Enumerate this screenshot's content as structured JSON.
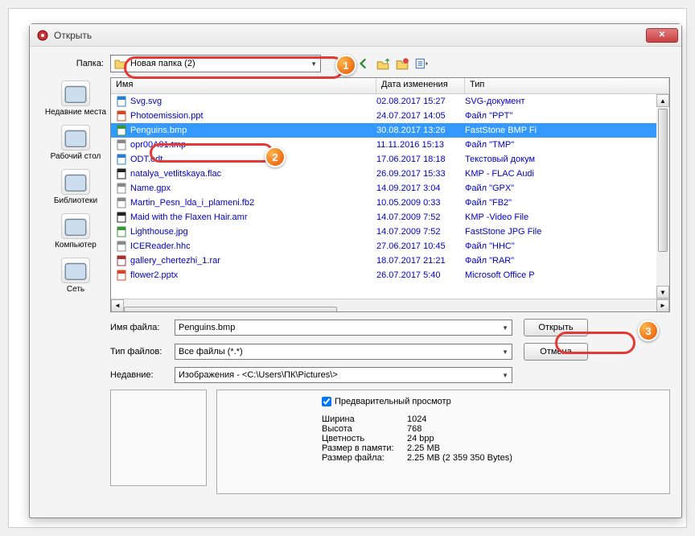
{
  "window": {
    "title": "Открыть"
  },
  "folderRow": {
    "label": "Папка:",
    "value": "Новая папка (2)"
  },
  "toolbar": {
    "back": "back-icon",
    "up": "up-icon",
    "newfolder": "newfolder-icon",
    "viewmenu": "viewmenu-icon"
  },
  "places": [
    {
      "label": "Недавние места"
    },
    {
      "label": "Рабочий стол"
    },
    {
      "label": "Библиотеки"
    },
    {
      "label": "Компьютер"
    },
    {
      "label": "Сеть"
    }
  ],
  "columns": {
    "name": "Имя",
    "date": "Дата изменения",
    "type": "Тип"
  },
  "files": [
    {
      "name": "Svg.svg",
      "date": "02.08.2017 15:27",
      "type": "SVG-документ",
      "sel": false,
      "iconColor": "#2b7cd3"
    },
    {
      "name": "Photoemission.ppt",
      "date": "24.07.2017 14:05",
      "type": "Файл \"PPT\"",
      "sel": false,
      "iconColor": "#d04828"
    },
    {
      "name": "Penguins.bmp",
      "date": "30.08.2017 13:26",
      "type": "FastStone BMP Fi",
      "sel": true,
      "iconColor": "#3a943a"
    },
    {
      "name": "opr00A91.tmp",
      "date": "11.11.2016 15:13",
      "type": "Файл \"TMP\"",
      "sel": false,
      "iconColor": "#888888"
    },
    {
      "name": "ODT.odt",
      "date": "17.06.2017 18:18",
      "type": "Текстовый докум",
      "sel": false,
      "iconColor": "#2b7cd3"
    },
    {
      "name": "natalya_vetlitskaya.flac",
      "date": "26.09.2017 15:33",
      "type": "KMP - FLAC Audi",
      "sel": false,
      "iconColor": "#222222"
    },
    {
      "name": "Name.gpx",
      "date": "14.09.2017 3:04",
      "type": "Файл \"GPX\"",
      "sel": false,
      "iconColor": "#888888"
    },
    {
      "name": "Martin_Pesn_lda_i_plameni.fb2",
      "date": "10.05.2009 0:33",
      "type": "Файл \"FB2\"",
      "sel": false,
      "iconColor": "#888888"
    },
    {
      "name": "Maid with the Flaxen Hair.amr",
      "date": "14.07.2009 7:52",
      "type": "KMP -Video File",
      "sel": false,
      "iconColor": "#222222"
    },
    {
      "name": "Lighthouse.jpg",
      "date": "14.07.2009 7:52",
      "type": "FastStone JPG File",
      "sel": false,
      "iconColor": "#3a943a"
    },
    {
      "name": "ICEReader.hhc",
      "date": "27.06.2017 10:45",
      "type": "Файл \"HHC\"",
      "sel": false,
      "iconColor": "#888888"
    },
    {
      "name": "gallery_chertezhi_1.rar",
      "date": "18.07.2017 21:21",
      "type": "Файл \"RAR\"",
      "sel": false,
      "iconColor": "#a33232"
    },
    {
      "name": "flower2.pptx",
      "date": "26.07.2017 5:40",
      "type": "Microsoft Office P",
      "sel": false,
      "iconColor": "#d04828"
    }
  ],
  "filenameRow": {
    "label": "Имя файла:",
    "value": "Penguins.bmp"
  },
  "filetypeRow": {
    "label": "Тип файлов:",
    "value": "Все файлы (*.*)"
  },
  "recentRow": {
    "label": "Недавние:",
    "value": "Изображения  -  <C:\\Users\\ПК\\Pictures\\>"
  },
  "buttons": {
    "open": "Открыть",
    "cancel": "Отмена"
  },
  "preview": {
    "checkboxLabel": "Предварительный просмотр",
    "props": [
      {
        "k": "Ширина",
        "v": "1024"
      },
      {
        "k": "Высота",
        "v": "768"
      },
      {
        "k": "Цветность",
        "v": "24 bpp"
      },
      {
        "k": "Размер в памяти:",
        "v": "2.25 MB"
      },
      {
        "k": "Размер файла:",
        "v": "2.25 MB (2 359 350 Bytes)"
      }
    ]
  },
  "badges": {
    "b1": "1",
    "b2": "2",
    "b3": "3"
  }
}
